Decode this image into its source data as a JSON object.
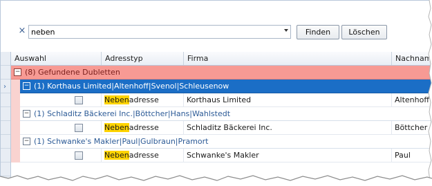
{
  "search": {
    "clear_symbol": "×",
    "value": "neben"
  },
  "buttons": {
    "find": "Finden",
    "clear": "Löschen"
  },
  "grid": {
    "columns": [
      "Auswahl",
      "Adresstyp",
      "Firma",
      "Nachname"
    ],
    "top_group": {
      "expander": "−",
      "label": "(8) Gefundene Dubletten"
    },
    "groups": [
      {
        "expander": "−",
        "label": "(1) Korthaus Limited|Altenhoff|Svenol|Schleusenow",
        "selected": true,
        "row": {
          "highlight": "Neben",
          "adresstyp_rest": "adresse",
          "firma": "Korthaus Limited",
          "nachname": "Altenhoff"
        }
      },
      {
        "expander": "−",
        "label": "(1) Schladitz Bäckerei Inc.|Böttcher|Hans|Wahlstedt",
        "selected": false,
        "row": {
          "highlight": "Neben",
          "adresstyp_rest": "adresse",
          "firma": "Schladitz Bäckerei Inc.",
          "nachname": "Böttcher"
        }
      },
      {
        "expander": "−",
        "label": "(1) Schwanke's Makler|Paul|Gulbraun|Pramort",
        "selected": false,
        "row": {
          "highlight": "Neben",
          "adresstyp_rest": "adresse",
          "firma": "Schwanke's Makler",
          "nachname": "Paul"
        }
      }
    ],
    "row_indicator": "›"
  },
  "colors": {
    "top_group_bg": "#f79a94",
    "selected_group_bg": "#1b6ec6",
    "highlight": "#ffd400"
  }
}
